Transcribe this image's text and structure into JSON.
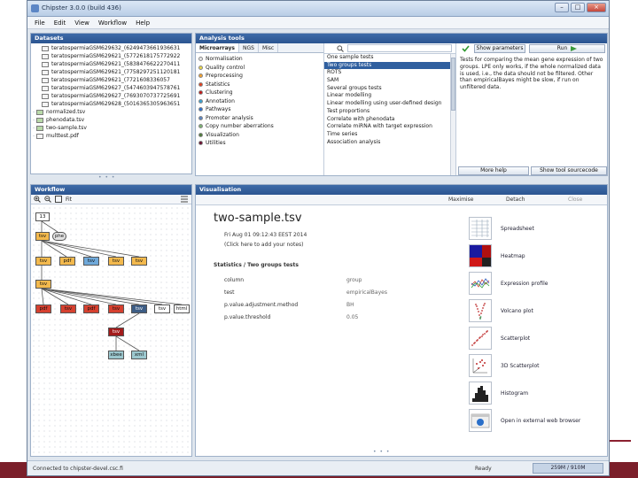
{
  "window": {
    "title": "Chipster 3.0.0 (build 436)",
    "minimize": "–",
    "maximize": "□",
    "close": "×"
  },
  "menu": [
    "File",
    "Edit",
    "View",
    "Workflow",
    "Help"
  ],
  "datasets": {
    "header": "Datasets",
    "items": [
      {
        "name": "teratospermiaGSM629632_(6249473661936631",
        "type": "cel",
        "depth": 1
      },
      {
        "name": "teratospermiaGSM629621_(5772618175772922",
        "type": "cel",
        "depth": 1
      },
      {
        "name": "teratospermiaGSM629621_(5838476622270411",
        "type": "cel",
        "depth": 1
      },
      {
        "name": "teratospermiaGSM629621_(7758297251120181",
        "type": "cel",
        "depth": 1
      },
      {
        "name": "teratospermiaGSM629621_(7721608336057",
        "type": "cel",
        "depth": 1
      },
      {
        "name": "teratospermiaGSM629627_(5474603947578761",
        "type": "cel",
        "depth": 1
      },
      {
        "name": "teratospermiaGSM629627_(7693070737725691",
        "type": "cel",
        "depth": 1
      },
      {
        "name": "teratospermiaGSM629628_(5016365305963651",
        "type": "cel",
        "depth": 1
      },
      {
        "name": "normalized.tsv",
        "type": "tsv",
        "depth": 2
      },
      {
        "name": "phenodata.tsv",
        "type": "tsv",
        "depth": 2
      },
      {
        "name": "two-sample.tsv",
        "type": "tsv",
        "depth": 2
      },
      {
        "name": "multtest.pdf",
        "type": "pdf",
        "depth": 2
      }
    ]
  },
  "analysis_tools": {
    "header": "Analysis tools",
    "tabs": [
      "Microarrays",
      "NGS",
      "Misc"
    ],
    "search_placeholder": "",
    "show_parameters": "Show parameters",
    "run": "Run",
    "categories": [
      {
        "label": "Normalisation",
        "color": "#e6e6e6"
      },
      {
        "label": "Quality control",
        "color": "#e8d64a"
      },
      {
        "label": "Preprocessing",
        "color": "#f0a030"
      },
      {
        "label": "Statistics",
        "color": "#e0401f"
      },
      {
        "label": "Clustering",
        "color": "#c01818"
      },
      {
        "label": "Annotation",
        "color": "#38a0d0"
      },
      {
        "label": "Pathways",
        "color": "#2c6fd0"
      },
      {
        "label": "Promoter analysis",
        "color": "#5a84c0"
      },
      {
        "label": "Copy number aberrations",
        "color": "#7ab070"
      },
      {
        "label": "Visualization",
        "color": "#4e7a3a"
      },
      {
        "label": "Utilities",
        "color": "#6a1030"
      }
    ],
    "tools": [
      "One sample tests",
      "Two groups tests",
      "ROTS",
      "SAM",
      "Several groups tests",
      "Linear modelling",
      "Linear modelling using user-defined design",
      "Test proportions",
      "Correlate with phenodata",
      "Correlate miRNA with target expression",
      "Time series",
      "Association analysis"
    ],
    "selected_tool_index": 1,
    "description": "Tests for comparing the mean gene expression of two groups. LPE only works, if the whole normalized data is used, i.e., the data should not be filtered. Other than empiricalBayes might be slow, if run on unfiltered data.",
    "more_help": "More help",
    "show_source": "Show tool sourcecode"
  },
  "workflow": {
    "header": "Workflow",
    "fit_label": "Fit",
    "nodes": {
      "root": "13",
      "level1a": "tsv",
      "level1b": "phe",
      "level2": [
        "tsv",
        "pdf",
        "tsv",
        "tsv",
        "tsv"
      ],
      "level3": "tsv",
      "level4": [
        "pdf",
        "tsv",
        "pdf",
        "tsv",
        "tsv",
        "tsv",
        "html"
      ],
      "level5": "tsv",
      "level6": [
        "xbee",
        "xml"
      ]
    }
  },
  "visualization": {
    "header": "Visualisation",
    "maximize": "Maximise",
    "detach": "Detach",
    "close": "Close",
    "title": "two-sample.tsv",
    "date": "Fri Aug 01 09:12:43 EEST 2014",
    "notes": "(Click here to add your notes)",
    "section": "Statistics / Two groups tests",
    "params": [
      {
        "name": "column",
        "value": "group"
      },
      {
        "name": "test",
        "value": "empiricalBayes"
      },
      {
        "name": "p.value.adjustment.method",
        "value": "BH"
      },
      {
        "name": "p.value.threshold",
        "value": "0.05"
      }
    ],
    "methods": [
      "Spreadsheet",
      "Heatmap",
      "Expression profile",
      "Volcano plot",
      "Scatterplot",
      "3D Scatterplot",
      "Histogram",
      "Open in external web browser"
    ]
  },
  "status": {
    "message": "Connected to chipster-devel.csc.fi",
    "ready": "Ready",
    "memory": "259M / 910M"
  }
}
